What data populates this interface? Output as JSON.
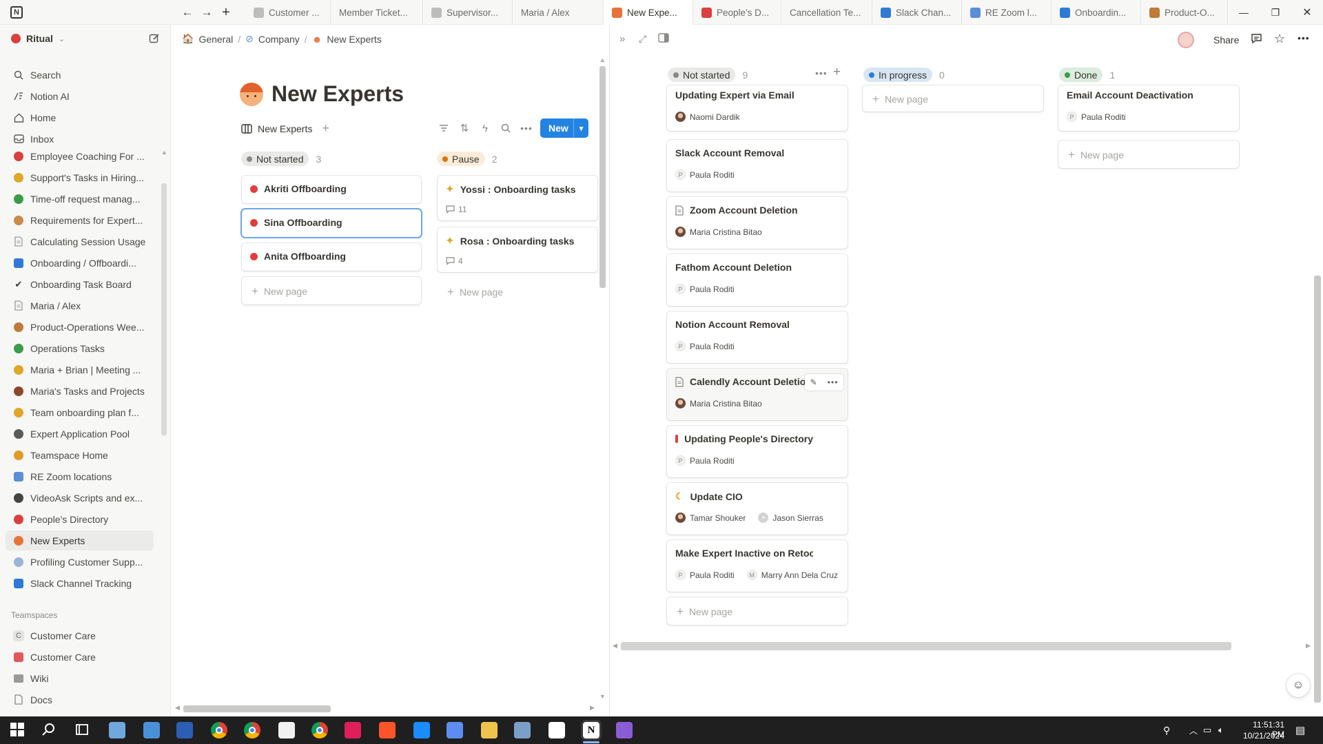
{
  "app": {
    "name": "Notion"
  },
  "tabs": [
    {
      "label": "Customer ...",
      "icon": "page-icon",
      "color": "#bdbdbb"
    },
    {
      "label": "Member Ticket...",
      "icon": "none",
      "color": ""
    },
    {
      "label": "Supervisor...",
      "icon": "grid-icon",
      "color": "#bdbdbb"
    },
    {
      "label": "Maria / Alex",
      "icon": "none",
      "color": ""
    },
    {
      "label": "New Expe...",
      "icon": "redhead-emoji-icon",
      "color": "#e8733a"
    },
    {
      "label": "People's D...",
      "icon": "telephone-icon",
      "color": "#d9413e"
    },
    {
      "label": "Cancellation Te...",
      "icon": "none",
      "color": ""
    },
    {
      "label": "Slack Chan...",
      "icon": "hash-icon",
      "color": "#2f7ad6"
    },
    {
      "label": "RE Zoom l...",
      "icon": "monitor-icon",
      "color": "#5b8ed6"
    },
    {
      "label": "Onboardin...",
      "icon": "new-badge-icon",
      "color": "#2f7ad6"
    },
    {
      "label": "Product-O...",
      "icon": "tools-icon",
      "color": "#c07a3a"
    }
  ],
  "sidebar": {
    "workspace": "Ritual",
    "top": [
      {
        "label": "Search",
        "icon": "search-icon"
      },
      {
        "label": "Notion AI",
        "icon": "ai-icon"
      },
      {
        "label": "Home",
        "icon": "home-icon"
      },
      {
        "label": "Inbox",
        "icon": "inbox-icon"
      }
    ],
    "pages": [
      {
        "label": "Employee Coaching For ...",
        "icon": "coach-icon",
        "color": "#d9413e"
      },
      {
        "label": "Support's Tasks in Hiring...",
        "icon": "construction-icon",
        "color": "#e0a626"
      },
      {
        "label": "Time-off request manag...",
        "icon": "palm-tree-icon",
        "color": "#3a9b4a"
      },
      {
        "label": "Requirements for Expert...",
        "icon": "clipboard-icon",
        "color": "#c98a4a"
      },
      {
        "label": "Calculating Session Usage",
        "icon": "page-icon",
        "color": "#9b9a97"
      },
      {
        "label": "Onboarding / Offboardi...",
        "icon": "new-badge-icon",
        "color": "#2f7ad6"
      },
      {
        "label": "Onboarding Task Board",
        "icon": "checkmark-icon",
        "color": "#37352f"
      },
      {
        "label": "Maria / Alex",
        "icon": "page-icon",
        "color": "#9b9a97"
      },
      {
        "label": "Product-Operations Wee...",
        "icon": "tools-icon",
        "color": "#c07a3a"
      },
      {
        "label": "Operations Tasks",
        "icon": "checklist-icon",
        "color": "#3a9b4a"
      },
      {
        "label": "Maria + Brian | Meeting ...",
        "icon": "sunrise-icon",
        "color": "#e0a626"
      },
      {
        "label": "Maria's Tasks and Projects",
        "icon": "butterfly-icon",
        "color": "#8a4a2a"
      },
      {
        "label": "Team onboarding plan f...",
        "icon": "moon-icon",
        "color": "#e0a626"
      },
      {
        "label": "Expert Application Pool",
        "icon": "person-icon",
        "color": "#5a5a5a"
      },
      {
        "label": "Teamspace Home",
        "icon": "people-icon",
        "color": "#e09a26"
      },
      {
        "label": "RE Zoom locations",
        "icon": "monitor-icon",
        "color": "#5b8ed6"
      },
      {
        "label": "VideoAsk Scripts and ex...",
        "icon": "camera-icon",
        "color": "#444444"
      },
      {
        "label": "People's Directory",
        "icon": "telephone-icon",
        "color": "#d9413e"
      },
      {
        "label": "New Experts",
        "icon": "redhead-emoji-icon",
        "color": "#e8733a"
      },
      {
        "label": "Profiling Customer Supp...",
        "icon": "cloud-icon",
        "color": "#9bb3d6"
      },
      {
        "label": "Slack Channel Tracking",
        "icon": "hash-icon",
        "color": "#2f7ad6"
      }
    ],
    "teamspaces_heading": "Teamspaces",
    "teamspaces": [
      {
        "label": "Customer Care",
        "icon": "letter-c-icon",
        "letter": "C",
        "color": "#e3e3e1"
      },
      {
        "label": "Customer Care",
        "icon": "customer-care-icon",
        "letter": "",
        "color": "#e05a5a"
      },
      {
        "label": "Wiki",
        "icon": "book-icon",
        "letter": "",
        "color": "#9b9a97"
      },
      {
        "label": "Docs",
        "icon": "page-icon",
        "letter": "",
        "color": "#9b9a97"
      }
    ]
  },
  "left": {
    "breadcrumb": [
      "General",
      "Company",
      "New Experts"
    ],
    "title": "New Experts",
    "view_tab": "New Experts",
    "new_label": "New",
    "groups": [
      {
        "name": "Not started",
        "count": "3",
        "bg": "#e9e9e7",
        "dot": "#8a8985",
        "cards": [
          "Akriti Offboarding",
          "Sina Offboarding",
          "Anita Offboarding"
        ]
      },
      {
        "name": "Pause",
        "count": "2",
        "bg": "#fbecd9",
        "dot": "#d9730d",
        "cards": [
          {
            "title": "Yossi : Onboarding tasks",
            "comments": "11"
          },
          {
            "title": "Rosa : Onboarding tasks",
            "comments": "4"
          }
        ]
      }
    ],
    "new_page": "New page"
  },
  "right": {
    "share": "Share",
    "groups": [
      {
        "name": "Not started",
        "count": "9",
        "bg": "#e9e9e7",
        "dot": "#8a8985"
      },
      {
        "name": "In progress",
        "count": "0",
        "bg": "#d8e6f4",
        "dot": "#2f7ad6"
      },
      {
        "name": "Done",
        "count": "1",
        "bg": "#dcecdf",
        "dot": "#3a9b4a"
      }
    ],
    "not_started": [
      {
        "title": "Updating Expert via Email",
        "icon": "",
        "people": [
          {
            "name": "Naomi Dardik",
            "avatar": "photo-avatar"
          }
        ]
      },
      {
        "title": "Slack Account Removal",
        "icon": "",
        "people": [
          {
            "name": "Paula Roditi",
            "avatar": "letter",
            "letter": "P"
          }
        ]
      },
      {
        "title": "Zoom Account Deletion",
        "icon": "page-icon",
        "people": [
          {
            "name": "Maria Cristina Bitao",
            "avatar": "photo-avatar"
          }
        ]
      },
      {
        "title": "Fathom Account Deletion",
        "icon": "",
        "people": [
          {
            "name": "Paula Roditi",
            "avatar": "letter",
            "letter": "P"
          }
        ]
      },
      {
        "title": "Notion Account Removal",
        "icon": "",
        "people": [
          {
            "name": "Paula Roditi",
            "avatar": "letter",
            "letter": "P"
          }
        ]
      },
      {
        "title": "Calendly Account Deletion",
        "icon": "page-icon",
        "people": [
          {
            "name": "Maria Cristina Bitao",
            "avatar": "photo-avatar"
          }
        ]
      },
      {
        "title": "Updating People's Directory",
        "icon": "telephone-icon",
        "people": [
          {
            "name": "Paula Roditi",
            "avatar": "letter",
            "letter": "P"
          }
        ]
      },
      {
        "title": "Update CIO",
        "icon": "moon-icon",
        "people": [
          {
            "name": "Tamar Shouker",
            "avatar": "photo-avatar"
          },
          {
            "name": "Jason Sierras",
            "avatar": "person-avatar"
          }
        ]
      },
      {
        "title": "Make Expert Inactive on Retool",
        "icon": "",
        "people": [
          {
            "name": "Paula Roditi",
            "avatar": "letter",
            "letter": "P"
          },
          {
            "name": "Marry Ann Dela Cruz",
            "avatar": "letter",
            "letter": "M"
          }
        ]
      }
    ],
    "done": [
      {
        "title": "Email Account Deactivation",
        "people": [
          {
            "name": "Paula Roditi",
            "avatar": "letter",
            "letter": "P"
          }
        ]
      }
    ],
    "new_page": "New page"
  },
  "taskbar": {
    "time": "11:51:31 PM",
    "date": "10/21/2024",
    "apps": [
      {
        "name": "start-icon",
        "color": "#3b8ee6"
      },
      {
        "name": "search-icon",
        "color": "#ffffff"
      },
      {
        "name": "task-view-icon",
        "color": "#ffffff"
      },
      {
        "name": "notepad-icon",
        "color": "#6fa8dc"
      },
      {
        "name": "files-icon",
        "color": "#4a90d9"
      },
      {
        "name": "word-icon",
        "color": "#2b5fb4"
      },
      {
        "name": "chrome-icon",
        "color": "#e9a23b"
      },
      {
        "name": "chrome-icon",
        "color": "#3c9b4a"
      },
      {
        "name": "badge-app-icon",
        "color": "#f1f1f1"
      },
      {
        "name": "chrome-icon",
        "color": "#d9413e"
      },
      {
        "name": "slack-icon",
        "color": "#e01e5a"
      },
      {
        "name": "brave-icon",
        "color": "#fb542b"
      },
      {
        "name": "1password-icon",
        "color": "#1a8cff"
      },
      {
        "name": "settings-app-icon",
        "color": "#5b8ef0"
      },
      {
        "name": "folder-icon",
        "color": "#f0c44c"
      },
      {
        "name": "app-icon",
        "color": "#7aa0c8"
      },
      {
        "name": "steam-icon",
        "color": "#ffffff"
      },
      {
        "name": "notion-icon",
        "color": "#ffffff"
      },
      {
        "name": "qt-icon",
        "color": "#8a5cd6"
      }
    ]
  }
}
